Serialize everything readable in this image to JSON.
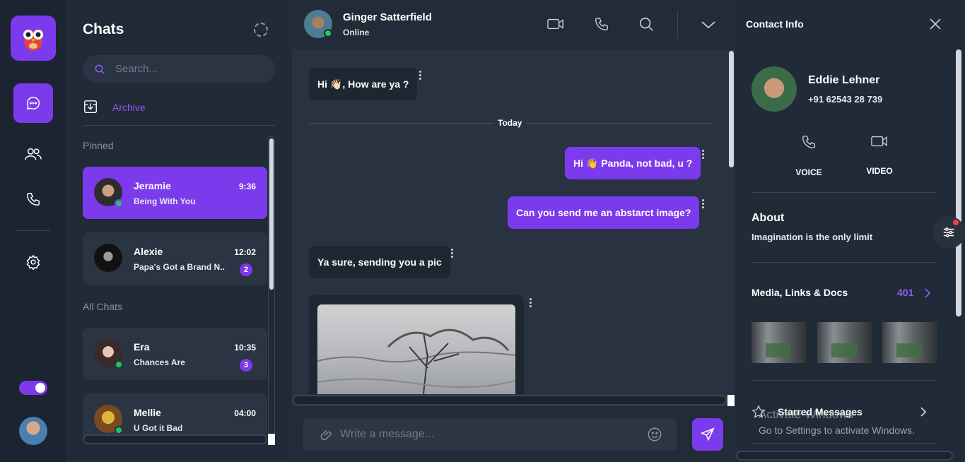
{
  "rail": {
    "logo_icon": "owl-logo-icon",
    "items": [
      {
        "icon": "chat-bubble-icon",
        "active": true
      },
      {
        "icon": "users-icon",
        "active": false
      },
      {
        "icon": "phone-icon",
        "active": false
      },
      {
        "icon": "gear-icon",
        "active": false
      }
    ],
    "theme_toggle_on": true
  },
  "chats": {
    "title": "Chats",
    "search_placeholder": "Search...",
    "archive_label": "Archive",
    "pinned_label": "Pinned",
    "all_label": "All Chats",
    "pinned": [
      {
        "name": "Jeramie",
        "message": "Being With You",
        "time": "9:36",
        "online": true,
        "unread": "",
        "active": true
      },
      {
        "name": "Alexie",
        "message": "Papa's Got a Brand N...",
        "time": "12:02",
        "online": false,
        "unread": "2",
        "active": false
      }
    ],
    "all": [
      {
        "name": "Era",
        "message": "Chances Are",
        "time": "10:35",
        "online": true,
        "unread": "3"
      },
      {
        "name": "Mellie",
        "message": "U Got it Bad",
        "time": "04:00",
        "online": true,
        "unread": ""
      }
    ]
  },
  "conversation": {
    "contact_name": "Ginger Satterfield",
    "status": "Online",
    "messages": [
      {
        "from": "them",
        "text": "Hi 👋🏻, How are ya ?"
      },
      {
        "from": "me",
        "text": "Hi 👋 Panda, not bad, u ?"
      },
      {
        "from": "me",
        "text": "Can you send me an abstarct image?"
      },
      {
        "from": "them",
        "text": "Ya sure, sending you a pic"
      }
    ],
    "divider_label": "Today",
    "compose_placeholder": "Write a message..."
  },
  "contact_info": {
    "title": "Contact Info",
    "name": "Eddie Lehner",
    "phone": "+91 62543 28 739",
    "voice_label": "VOICE",
    "video_label": "VIDEO",
    "about_title": "About",
    "about_text": "Imagination is the only limit",
    "media_title": "Media, Links & Docs",
    "media_count": "401",
    "starred_title": "Starred Messages"
  },
  "os_watermark": {
    "line1": "Activate Windows",
    "line2": "Go to Settings to activate Windows."
  },
  "colors": {
    "accent": "#7c3aed",
    "online": "#22c55e",
    "panel_bg": "#212a37",
    "chat_bg": "#293240"
  }
}
